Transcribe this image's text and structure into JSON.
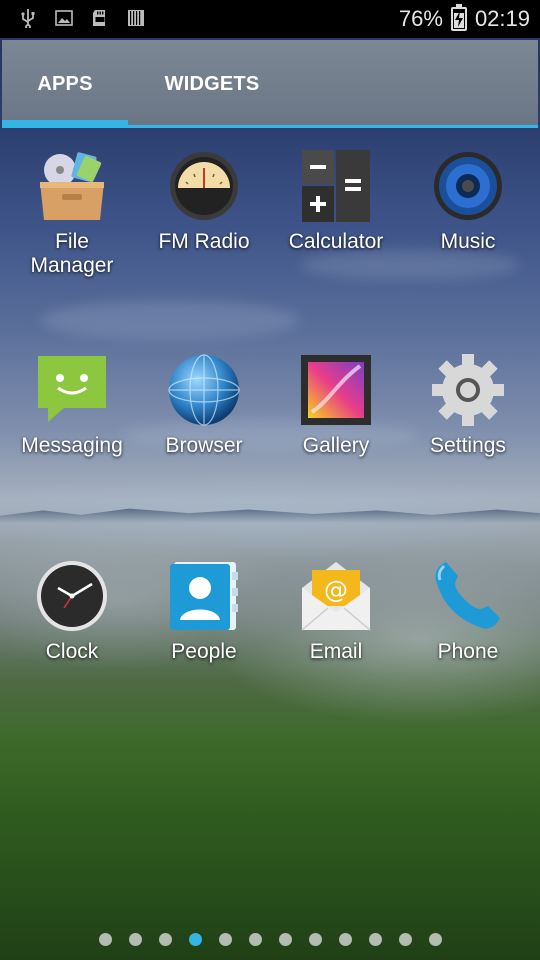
{
  "status_bar": {
    "battery_text": "76%",
    "battery_level": 0.76,
    "time": "02:19",
    "left_icons": [
      "usb-icon",
      "image-notification-icon",
      "sd-card-icon",
      "barcode-icon"
    ]
  },
  "tabs": [
    {
      "label": "APPS",
      "selected": true
    },
    {
      "label": "WIDGETS",
      "selected": false
    }
  ],
  "apps": [
    {
      "label": "File\nManager",
      "icon": "file-manager-icon"
    },
    {
      "label": "FM Radio",
      "icon": "fm-radio-icon"
    },
    {
      "label": "Calculator",
      "icon": "calculator-icon"
    },
    {
      "label": "Music",
      "icon": "music-icon"
    },
    {
      "label": "Messaging",
      "icon": "messaging-icon"
    },
    {
      "label": "Browser",
      "icon": "browser-icon"
    },
    {
      "label": "Gallery",
      "icon": "gallery-icon"
    },
    {
      "label": "Settings",
      "icon": "settings-icon"
    },
    {
      "label": "Clock",
      "icon": "clock-icon"
    },
    {
      "label": "People",
      "icon": "people-icon"
    },
    {
      "label": "Email",
      "icon": "email-icon"
    },
    {
      "label": "Phone",
      "icon": "phone-icon"
    }
  ],
  "pager": {
    "total": 12,
    "current": 4
  },
  "colors": {
    "accent": "#33b5e5",
    "tabbar": "#74808e",
    "statusbar": "#000000"
  }
}
